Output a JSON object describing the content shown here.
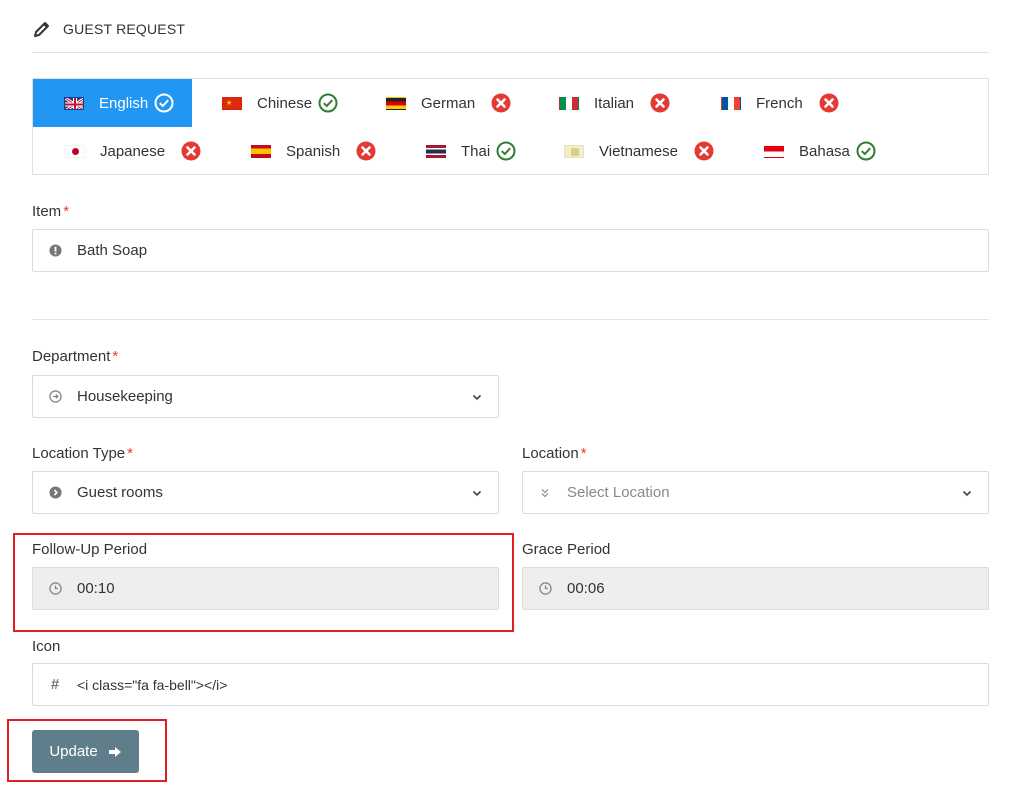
{
  "header": {
    "title": "GUEST REQUEST",
    "icon": "pencil-icon"
  },
  "languages": [
    {
      "name": "English",
      "status": "done",
      "active": true
    },
    {
      "name": "Chinese",
      "status": "done"
    },
    {
      "name": "German",
      "status": "missing"
    },
    {
      "name": "Italian",
      "status": "missing"
    },
    {
      "name": "French",
      "status": "missing"
    },
    {
      "name": "Japanese",
      "status": "missing"
    },
    {
      "name": "Spanish",
      "status": "missing"
    },
    {
      "name": "Thai",
      "status": "done"
    },
    {
      "name": "Vietnamese",
      "status": "missing"
    },
    {
      "name": "Bahasa",
      "status": "done"
    }
  ],
  "form": {
    "item": {
      "label": "Item",
      "value": "Bath Soap"
    },
    "department": {
      "label": "Department",
      "value": "Housekeeping"
    },
    "location_type": {
      "label": "Location Type",
      "value": "Guest rooms"
    },
    "location": {
      "label": "Location",
      "placeholder": "Select Location"
    },
    "follow_up": {
      "label": "Follow-Up Period",
      "value": "00:10"
    },
    "grace": {
      "label": "Grace Period",
      "value": "00:06"
    },
    "icon": {
      "label": "Icon",
      "value": "<i class=\"fa fa-bell\"></i>"
    },
    "required_mark": "*"
  },
  "update_button": {
    "label": "Update"
  },
  "colors": {
    "accent": "#2196f3",
    "button": "#607d8b",
    "error": "#e53935",
    "success": "#2e7d32",
    "highlight": "#e02020"
  }
}
